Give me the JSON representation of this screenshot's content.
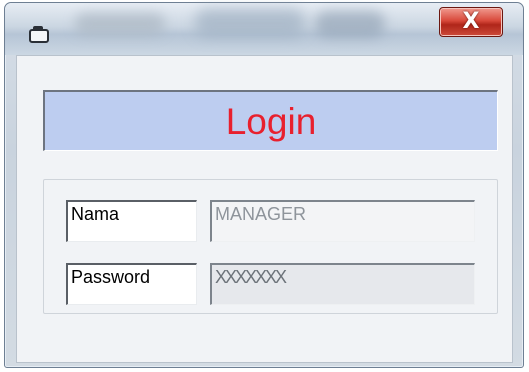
{
  "window": {
    "title": "",
    "close_label": "X"
  },
  "login_header": {
    "title": "Login",
    "title_color": "#e8202e",
    "background": "#bdcdf0"
  },
  "form": {
    "nama_label": "Nama",
    "nama_value": "MANAGER",
    "password_label": "Password",
    "password_value": "XXXXXXX"
  },
  "icons": {
    "app_icon": "window-app-icon",
    "close_icon": "close-icon"
  }
}
